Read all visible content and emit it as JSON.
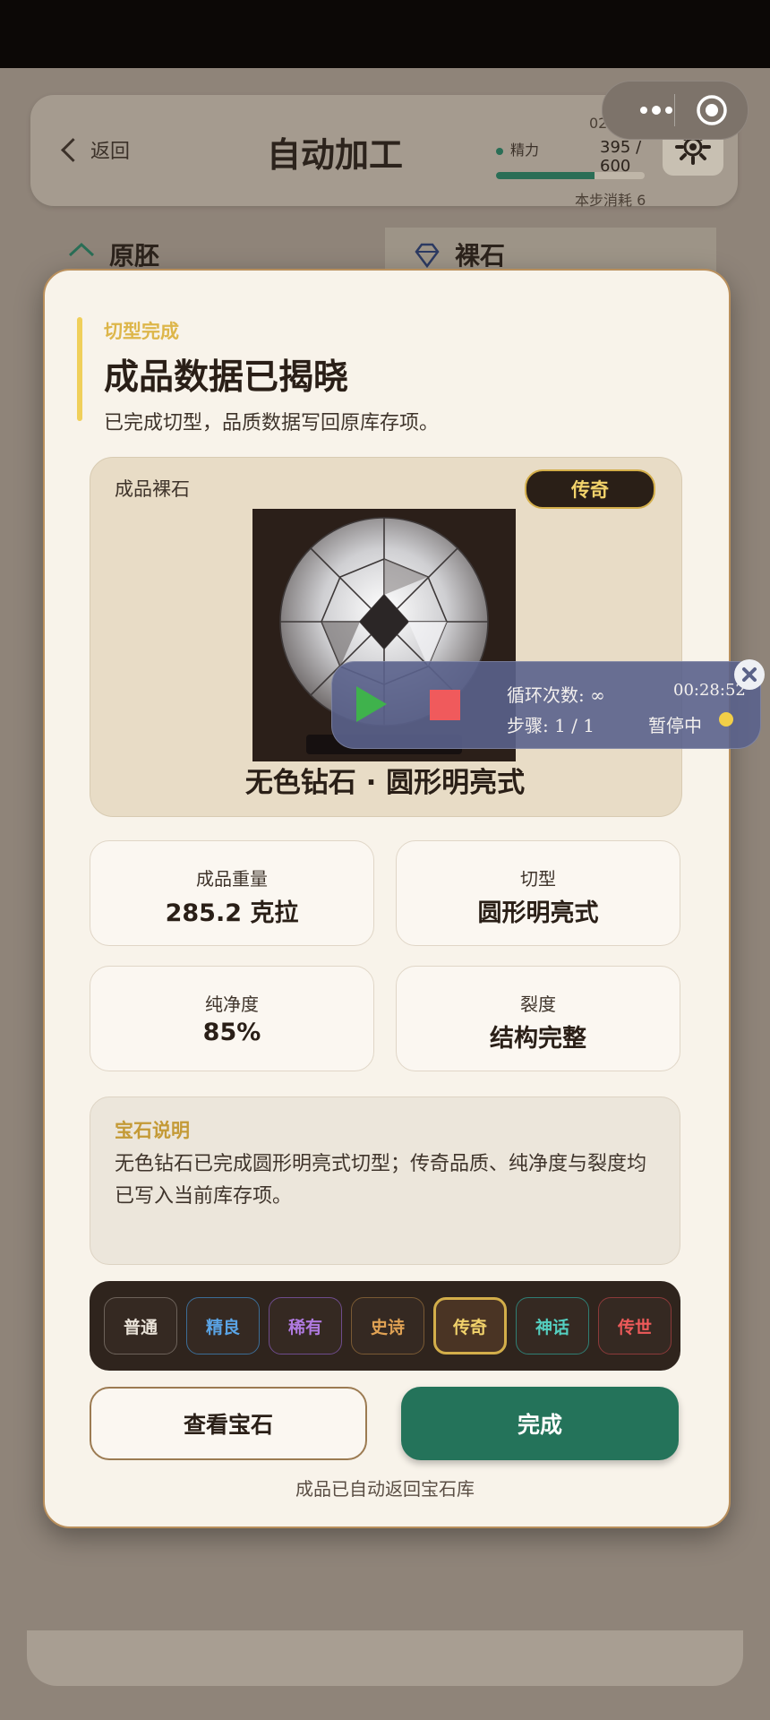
{
  "header": {
    "back_label": "返回",
    "title": "自动加工",
    "energy_label": "精力",
    "energy_value": "395 / 600",
    "energy_fraction": 0.66,
    "step_cost": "本步消耗 6",
    "step_counter": "02 / 02"
  },
  "bg_tabs": [
    {
      "label": "原胚",
      "icon": "house-icon"
    },
    {
      "label": "裸石",
      "icon": "gem-icon"
    }
  ],
  "modal": {
    "kicker": "切型完成",
    "title": "成品数据已揭晓",
    "subtitle": "已完成切型，品质数据写回原库存项。",
    "product_label": "成品裸石",
    "rarity_badge": "传奇",
    "gem_name": "无色钻石 · 圆形明亮式",
    "stats": [
      {
        "label": "成品重量",
        "value": "285.2 克拉"
      },
      {
        "label": "切型",
        "value": "圆形明亮式"
      },
      {
        "label": "纯净度",
        "value": "85%"
      },
      {
        "label": "裂度",
        "value": "结构完整"
      }
    ],
    "desc_title": "宝石说明",
    "desc_text": "无色钻石已完成圆形明亮式切型；传奇品质、纯净度与裂度均已写入当前库存项。",
    "rarities": [
      {
        "label": "普通",
        "color": "#e9e2d8",
        "border": "#6d625a",
        "active": false
      },
      {
        "label": "精良",
        "color": "#5aa4e6",
        "border": "#3c6d96",
        "active": false
      },
      {
        "label": "稀有",
        "color": "#b07ae0",
        "border": "#6e4c8c",
        "active": false
      },
      {
        "label": "史诗",
        "color": "#e0a254",
        "border": "#7a5a34",
        "active": false
      },
      {
        "label": "传奇",
        "color": "#f2d36b",
        "border": "#d3ae4a",
        "active": true
      },
      {
        "label": "神话",
        "color": "#54cfc0",
        "border": "#2f7e74",
        "active": false
      },
      {
        "label": "传世",
        "color": "#ee5a5a",
        "border": "#8c3a3a",
        "active": false
      }
    ],
    "view_button": "查看宝石",
    "done_button": "完成",
    "footer_note": "成品已自动返回宝石库"
  },
  "automation": {
    "loop_text": "循环次数: ∞",
    "timer": "00:28:52",
    "step_text": "步骤: 1 / 1",
    "status_text": "暂停中"
  }
}
